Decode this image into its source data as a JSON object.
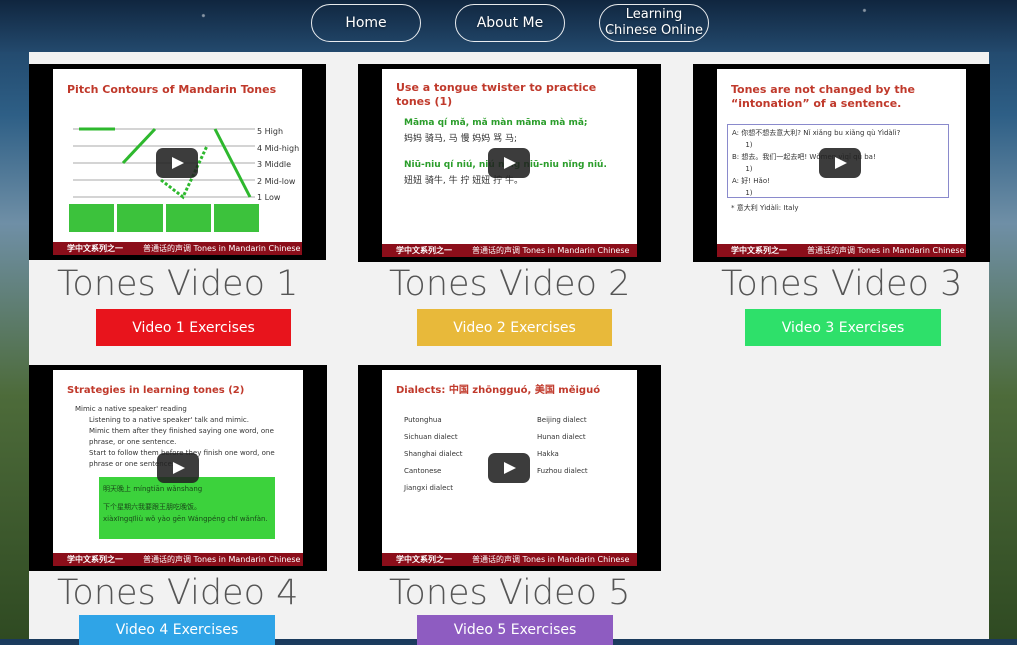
{
  "nav": {
    "home": "Home",
    "about": "About Me",
    "learning": "Learning\nChinese Online"
  },
  "videos": [
    {
      "title": "Tones Video 1",
      "exercise": "Video 1 Exercises",
      "color": "#e8141c",
      "slide_title": "Pitch Contours of Mandarin Tones",
      "slide_lines": [
        "5 High",
        "4 Mid-high",
        "3 Middle",
        "2 Mid-low",
        "1 Low"
      ],
      "footer_left": "学中文系列之一",
      "footer_right": "普通话的声调   Tones in Mandarin Chinese"
    },
    {
      "title": "Tones Video 2",
      "exercise": "Video 2 Exercises",
      "color": "#e8b93a",
      "slide_title": "Use a tongue twister to practice tones (1)",
      "slide_lines": [
        "Māma qí mǎ, mǎ màn māma mà mǎ;",
        "妈妈 骑马, 马 慢 妈妈 骂 马;",
        "Niū-niu qí niú, niú nìng niū-niu nǐng niú.",
        "妞妞 骑牛, 牛 拧 妞妞 拧 牛。"
      ],
      "footer_left": "学中文系列之一",
      "footer_right": "普通话的声调   Tones in Mandarin Chinese"
    },
    {
      "title": "Tones Video 3",
      "exercise": "Video 3 Exercises",
      "color": "#2ee06a",
      "slide_title": "Tones are not changed by the\n“intonation” of a sentence.",
      "slide_lines": [
        "A: 你想不想去意大利? Nǐ xiǎng bu xiǎng qù Yìdàlì?",
        "B: 想去。我们一起去吧! Wǒmen yìqǐ qù ba!",
        "A: 好! Hǎo!",
        "* 意大利 Yìdàlì: Italy"
      ],
      "footer_left": "学中文系列之一",
      "footer_right": "普通话的声调   Tones in Mandarin Chinese"
    },
    {
      "title": "Tones Video 4",
      "exercise": "Video 4 Exercises",
      "color": "#2fa4e7",
      "slide_title": "Strategies in learning tones (2)",
      "slide_lines": [
        "Mimic a native speaker' reading",
        "Listening to a native speaker' talk and mimic.",
        "Mimic them after they finished saying one word, one phrase, or one sentence.",
        "Start to follow them before they finish one word, one phrase or one sentence.",
        "明天晚上 míngtiān wǎnshang",
        "下个星期六我要跟王朋吃晚饭。",
        "xiàxīngqīliù wǒ yào gēn Wángpéng chī wǎnfàn."
      ],
      "footer_left": "学中文系列之一",
      "footer_right": "普通话的声调   Tones in Mandarin Chinese"
    },
    {
      "title": "Tones Video 5",
      "exercise": "Video 5 Exercises",
      "color": "#8e5cc1",
      "slide_title": "Dialects: 中国 zhōngguó, 美国 měiguó",
      "slide_lines": [
        "Putonghua",
        "Sichuan dialect",
        "Shanghai dialect",
        "Cantonese",
        "Jiangxi dialect",
        "Beijing dialect",
        "Hunan dialect",
        "Hakka",
        "Fuzhou dialect"
      ],
      "footer_left": "学中文系列之一",
      "footer_right": "普通话的声调   Tones in Mandarin Chinese"
    }
  ]
}
